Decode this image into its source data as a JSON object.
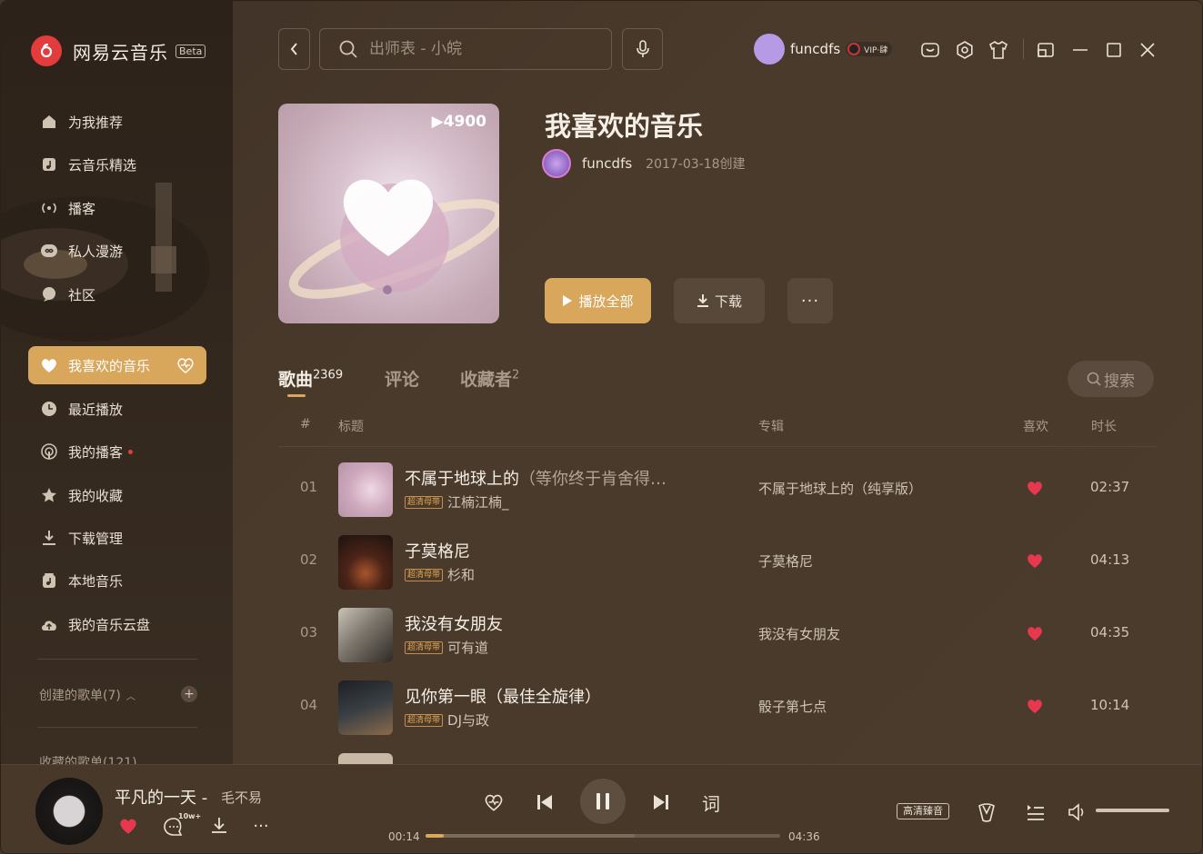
{
  "app": {
    "logo_text": "网易云音乐",
    "beta_label": "Beta"
  },
  "sidebar": {
    "items": [
      {
        "label": "为我推荐",
        "icon": "home-icon"
      },
      {
        "label": "云音乐精选",
        "icon": "music-note-icon"
      },
      {
        "label": "播客",
        "icon": "broadcast-icon"
      },
      {
        "label": "私人漫游",
        "icon": "infinity-icon"
      },
      {
        "label": "社区",
        "icon": "chat-bubble-icon"
      },
      {
        "label": "我喜欢的音乐",
        "icon": "heart-icon",
        "active": true
      },
      {
        "label": "最近播放",
        "icon": "clock-icon"
      },
      {
        "label": "我的播客",
        "icon": "podcast-icon"
      },
      {
        "label": "我的收藏",
        "icon": "star-icon"
      },
      {
        "label": "下载管理",
        "icon": "download-icon"
      },
      {
        "label": "本地音乐",
        "icon": "local-music-icon"
      },
      {
        "label": "我的音乐云盘",
        "icon": "cloud-upload-icon"
      }
    ],
    "created_playlists": "创建的歌单(7)",
    "collected_playlists": "收藏的歌单(121)"
  },
  "topbar": {
    "search_placeholder": "出师表 - 小皖",
    "user_name": "funcdfs",
    "vip_label": "VIP·肆"
  },
  "playlist": {
    "title": "我喜欢的音乐",
    "owner": "funcdfs",
    "created": "2017-03-18创建",
    "cover_play_count": "4900",
    "play_all": "播放全部",
    "download": "下载",
    "more": "···"
  },
  "tabs": [
    {
      "label": "歌曲",
      "count": "2369"
    },
    {
      "label": "评论",
      "count": ""
    },
    {
      "label": "收藏者",
      "count": "2"
    }
  ],
  "search_pill": "搜索",
  "table": {
    "headers": {
      "index": "#",
      "title": "标题",
      "album": "专辑",
      "like": "喜欢",
      "duration": "时长"
    },
    "rows": [
      {
        "idx": "01",
        "title": "不属于地球上的",
        "extra": "（等你终于肯舍得…",
        "tag": "超清母带",
        "artist": "江楠江楠_",
        "album": "不属于地球上的（纯享版）",
        "duration": "02:37"
      },
      {
        "idx": "02",
        "title": "子莫格尼",
        "extra": "",
        "tag": "超清母带",
        "artist": "杉和",
        "album": "子莫格尼",
        "duration": "04:13"
      },
      {
        "idx": "03",
        "title": "我没有女朋友",
        "extra": "",
        "tag": "超清母带",
        "artist": "可有道",
        "album": "我没有女朋友",
        "duration": "04:35"
      },
      {
        "idx": "04",
        "title": "见你第一眼（最佳全旋律）",
        "extra": "",
        "tag": "超清母带",
        "artist": "DJ与政",
        "album": "骰子第七点",
        "duration": "10:14"
      }
    ]
  },
  "player": {
    "title": "平凡的一天 -",
    "artist": "毛不易",
    "comment_count": "10w+",
    "current_time": "00:14",
    "total_time": "04:36",
    "progress": 0.05,
    "buffered": 0.59,
    "lyrics_label": "词",
    "quality": "高清臻音"
  },
  "colors": {
    "accent": "#d9a75c",
    "like_red": "#e8384f",
    "brand_red": "#e33c3c"
  }
}
